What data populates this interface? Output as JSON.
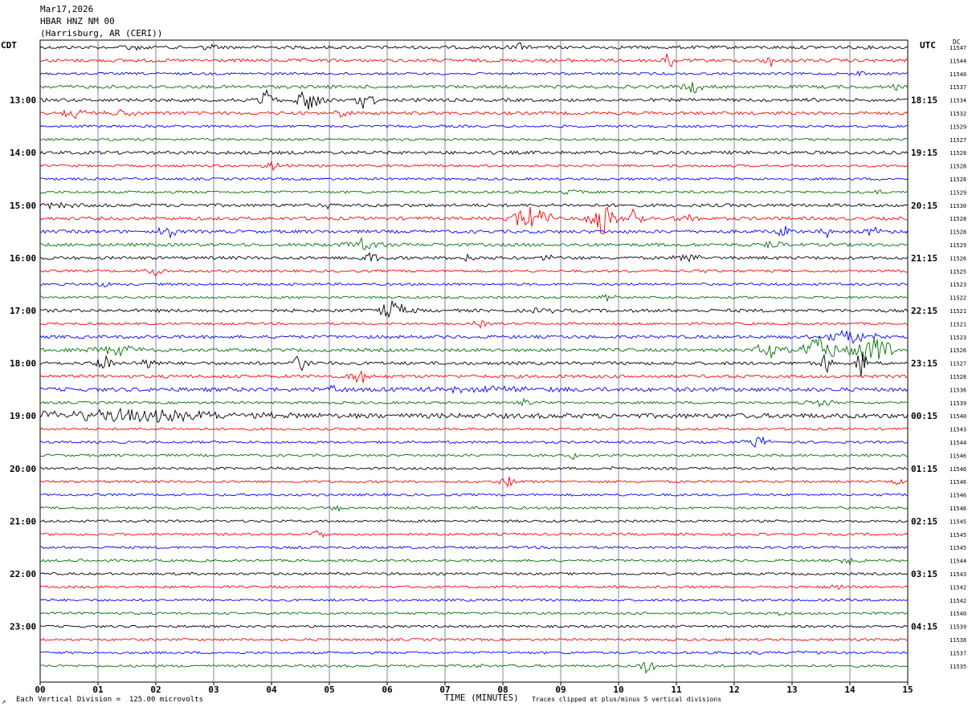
{
  "header": {
    "date": "Mar17,2026",
    "station": "HBAR HNZ NM 00",
    "location": "(Harrisburg, AR (CERI))"
  },
  "side_labels": {
    "left_tz": "CDT",
    "right_tz": "UTC",
    "dc_label": "DC"
  },
  "footer": {
    "scale_note": "Each Vertical Division =  125.00 microvolts",
    "xaxis_label": "TIME (MINUTES)",
    "clip_note": "Traces clipped at plus/minus 5 vertical divisions",
    "corner_mark": "↗"
  },
  "colors": {
    "trace_cycle": [
      "#000000",
      "#ff0000",
      "#0000ff",
      "#007000"
    ],
    "grid": "#8080b0",
    "background": "#ffffff"
  },
  "chart_data": {
    "type": "helicorder",
    "x": {
      "label": "TIME (MINUTES)",
      "range": [
        0,
        15
      ],
      "tick_labels": [
        "00",
        "01",
        "02",
        "03",
        "04",
        "05",
        "06",
        "07",
        "08",
        "09",
        "10",
        "11",
        "12",
        "13",
        "14",
        "15"
      ]
    },
    "left_time_labels": [
      {
        "trace": 4,
        "text": "13:00"
      },
      {
        "trace": 8,
        "text": "14:00"
      },
      {
        "trace": 12,
        "text": "15:00"
      },
      {
        "trace": 16,
        "text": "16:00"
      },
      {
        "trace": 20,
        "text": "17:00"
      },
      {
        "trace": 24,
        "text": "18:00"
      },
      {
        "trace": 28,
        "text": "19:00"
      },
      {
        "trace": 32,
        "text": "20:00"
      },
      {
        "trace": 36,
        "text": "21:00"
      },
      {
        "trace": 40,
        "text": "22:00"
      },
      {
        "trace": 44,
        "text": "23:00"
      }
    ],
    "right_time_labels": [
      {
        "trace": 4,
        "text": "18:15"
      },
      {
        "trace": 8,
        "text": "19:15"
      },
      {
        "trace": 12,
        "text": "20:15"
      },
      {
        "trace": 16,
        "text": "21:15"
      },
      {
        "trace": 20,
        "text": "22:15"
      },
      {
        "trace": 24,
        "text": "23:15"
      },
      {
        "trace": 28,
        "text": "00:15"
      },
      {
        "trace": 32,
        "text": "01:15"
      },
      {
        "trace": 36,
        "text": "02:15"
      },
      {
        "trace": 40,
        "text": "03:15"
      },
      {
        "trace": 44,
        "text": "04:15"
      }
    ],
    "dc_offsets": [
      11547,
      11544,
      11540,
      11537,
      11534,
      11532,
      11529,
      11527,
      11528,
      11528,
      11528,
      11529,
      11530,
      11528,
      11528,
      11529,
      11526,
      11525,
      11523,
      11522,
      11521,
      11521,
      11523,
      11526,
      11527,
      11528,
      11536,
      11539,
      11540,
      11543,
      11544,
      11546,
      11546,
      11546,
      11546,
      11546,
      11545,
      11545,
      11545,
      11544,
      11543,
      11542,
      11542,
      11540,
      11539,
      11538,
      11537,
      11535
    ],
    "noise": [
      2,
      2,
      1.5,
      2,
      2,
      2,
      1.5,
      1.5,
      2,
      1.5,
      1.5,
      1.5,
      2,
      2,
      2,
      2,
      2,
      1.5,
      1.5,
      1.5,
      2,
      1.5,
      2,
      2,
      2,
      2,
      2.5,
      1.5,
      3,
      1.5,
      1.5,
      1.5,
      1.5,
      1.5,
      1.5,
      1.5,
      1.5,
      1.5,
      1.5,
      1.5,
      1.5,
      1.5,
      1.5,
      1.5,
      1.5,
      1.5,
      1.5,
      1.5
    ],
    "events": [
      {
        "trace": 0,
        "min": 1.6,
        "amp": 5,
        "dur": 0.5
      },
      {
        "trace": 0,
        "min": 2.9,
        "amp": 5,
        "dur": 0.3
      },
      {
        "trace": 0,
        "min": 8.3,
        "amp": 6,
        "dur": 0.3
      },
      {
        "trace": 1,
        "min": 10.9,
        "amp": 12,
        "dur": 0.3
      },
      {
        "trace": 1,
        "min": 12.6,
        "amp": 12,
        "dur": 0.2
      },
      {
        "trace": 2,
        "min": 14.2,
        "amp": 4,
        "dur": 0.3
      },
      {
        "trace": 3,
        "min": 11.3,
        "amp": 8,
        "dur": 0.4
      },
      {
        "trace": 3,
        "min": 14.8,
        "amp": 10,
        "dur": 0.1
      },
      {
        "trace": 4,
        "min": 3.9,
        "amp": 14,
        "dur": 0.4
      },
      {
        "trace": 4,
        "min": 4.6,
        "amp": 16,
        "dur": 0.5
      },
      {
        "trace": 4,
        "min": 5.6,
        "amp": 15,
        "dur": 0.4
      },
      {
        "trace": 4,
        "min": 6.5,
        "amp": 7,
        "dur": 0.2
      },
      {
        "trace": 4,
        "min": 13.3,
        "amp": 5,
        "dur": 0.2
      },
      {
        "trace": 5,
        "min": 0.6,
        "amp": 10,
        "dur": 0.4
      },
      {
        "trace": 5,
        "min": 1.4,
        "amp": 4,
        "dur": 0.8
      },
      {
        "trace": 5,
        "min": 5.2,
        "amp": 4,
        "dur": 0.5
      },
      {
        "trace": 9,
        "min": 4.0,
        "amp": 5,
        "dur": 0.5
      },
      {
        "trace": 11,
        "min": 9.2,
        "amp": 5,
        "dur": 0.4
      },
      {
        "trace": 11,
        "min": 14.5,
        "amp": 4,
        "dur": 0.3
      },
      {
        "trace": 12,
        "min": 0.3,
        "amp": 4,
        "dur": 0.8
      },
      {
        "trace": 12,
        "min": 5.0,
        "amp": 5,
        "dur": 0.4
      },
      {
        "trace": 13,
        "min": 8.5,
        "amp": 22,
        "dur": 0.6
      },
      {
        "trace": 13,
        "min": 9.7,
        "amp": 25,
        "dur": 0.5
      },
      {
        "trace": 13,
        "min": 10.3,
        "amp": 25,
        "dur": 0.2
      },
      {
        "trace": 13,
        "min": 11.2,
        "amp": 5,
        "dur": 0.5
      },
      {
        "trace": 14,
        "min": 2.2,
        "amp": 14,
        "dur": 0.3
      },
      {
        "trace": 14,
        "min": 12.9,
        "amp": 10,
        "dur": 0.3
      },
      {
        "trace": 14,
        "min": 13.6,
        "amp": 8,
        "dur": 0.2
      },
      {
        "trace": 14,
        "min": 14.4,
        "amp": 6,
        "dur": 0.4
      },
      {
        "trace": 15,
        "min": 5.6,
        "amp": 8,
        "dur": 0.6
      },
      {
        "trace": 15,
        "min": 12.7,
        "amp": 6,
        "dur": 0.3
      },
      {
        "trace": 16,
        "min": 5.7,
        "amp": 6,
        "dur": 0.4
      },
      {
        "trace": 16,
        "min": 7.4,
        "amp": 5,
        "dur": 0.4
      },
      {
        "trace": 16,
        "min": 8.8,
        "amp": 5,
        "dur": 0.4
      },
      {
        "trace": 16,
        "min": 11.2,
        "amp": 8,
        "dur": 0.4
      },
      {
        "trace": 17,
        "min": 2.0,
        "amp": 6,
        "dur": 0.4
      },
      {
        "trace": 17,
        "min": 11.5,
        "amp": 3,
        "dur": 0.4
      },
      {
        "trace": 18,
        "min": 1.1,
        "amp": 5,
        "dur": 0.3
      },
      {
        "trace": 19,
        "min": 9.8,
        "amp": 4,
        "dur": 0.3
      },
      {
        "trace": 20,
        "min": 6.1,
        "amp": 12,
        "dur": 0.6
      },
      {
        "trace": 20,
        "min": 8.7,
        "amp": 3,
        "dur": 0.5
      },
      {
        "trace": 21,
        "min": 7.6,
        "amp": 6,
        "dur": 0.3
      },
      {
        "trace": 22,
        "min": 14.0,
        "amp": 10,
        "dur": 1.0
      },
      {
        "trace": 23,
        "min": 1.4,
        "amp": 6,
        "dur": 1.2
      },
      {
        "trace": 23,
        "min": 13.5,
        "amp": 24,
        "dur": 0.6
      },
      {
        "trace": 23,
        "min": 14.4,
        "amp": 22,
        "dur": 0.8
      },
      {
        "trace": 23,
        "min": 12.6,
        "amp": 10,
        "dur": 0.6
      },
      {
        "trace": 24,
        "min": 1.1,
        "amp": 12,
        "dur": 0.3
      },
      {
        "trace": 24,
        "min": 1.9,
        "amp": 10,
        "dur": 0.3
      },
      {
        "trace": 24,
        "min": 4.5,
        "amp": 12,
        "dur": 0.4
      },
      {
        "trace": 24,
        "min": 13.6,
        "amp": 14,
        "dur": 0.3
      },
      {
        "trace": 24,
        "min": 14.2,
        "amp": 20,
        "dur": 0.2
      },
      {
        "trace": 25,
        "min": 5.5,
        "amp": 14,
        "dur": 0.3
      },
      {
        "trace": 26,
        "min": 5.1,
        "amp": 6,
        "dur": 0.4
      },
      {
        "trace": 26,
        "min": 7.8,
        "amp": 4,
        "dur": 2.5
      },
      {
        "trace": 27,
        "min": 8.4,
        "amp": 6,
        "dur": 0.4
      },
      {
        "trace": 27,
        "min": 13.5,
        "amp": 6,
        "dur": 0.5
      },
      {
        "trace": 28,
        "min": 1.5,
        "amp": 8,
        "dur": 4.5
      },
      {
        "trace": 30,
        "min": 12.4,
        "amp": 10,
        "dur": 0.4
      },
      {
        "trace": 31,
        "min": 9.2,
        "amp": 5,
        "dur": 0.4
      },
      {
        "trace": 32,
        "min": 4.0,
        "amp": 3,
        "dur": 0.2
      },
      {
        "trace": 32,
        "min": 9.9,
        "amp": 3,
        "dur": 0.2
      },
      {
        "trace": 33,
        "min": 8.1,
        "amp": 8,
        "dur": 0.3
      },
      {
        "trace": 33,
        "min": 14.8,
        "amp": 5,
        "dur": 0.3
      },
      {
        "trace": 35,
        "min": 5.1,
        "amp": 5,
        "dur": 0.3
      },
      {
        "trace": 37,
        "min": 4.8,
        "amp": 8,
        "dur": 0.3
      },
      {
        "trace": 39,
        "min": 0.7,
        "amp": 6,
        "dur": 0.1
      },
      {
        "trace": 39,
        "min": 14.0,
        "amp": 6,
        "dur": 0.4
      },
      {
        "trace": 41,
        "min": 13.8,
        "amp": 4,
        "dur": 0.3
      },
      {
        "trace": 43,
        "min": 12.8,
        "amp": 3,
        "dur": 0.2
      },
      {
        "trace": 46,
        "min": 12.4,
        "amp": 3,
        "dur": 0.3
      },
      {
        "trace": 46,
        "min": 13.2,
        "amp": 3,
        "dur": 0.6
      },
      {
        "trace": 47,
        "min": 7.6,
        "amp": 4,
        "dur": 0.3
      },
      {
        "trace": 47,
        "min": 10.5,
        "amp": 10,
        "dur": 0.3
      }
    ]
  }
}
